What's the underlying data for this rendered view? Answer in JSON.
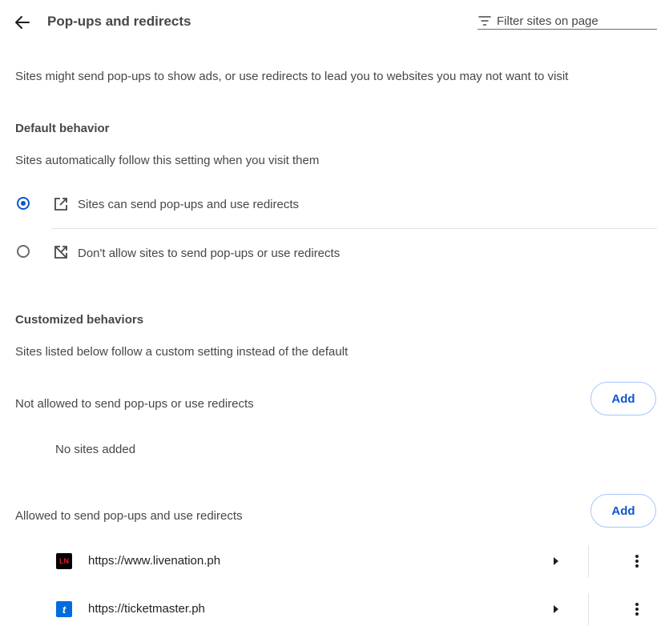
{
  "header": {
    "title": "Pop-ups and redirects",
    "filter_placeholder": "Filter sites on page"
  },
  "description": "Sites might send pop-ups to show ads, or use redirects to lead you to websites you may not want to visit",
  "default_behavior": {
    "heading": "Default behavior",
    "subtext": "Sites automatically follow this setting when you visit them",
    "options": [
      {
        "label": "Sites can send pop-ups and use redirects",
        "selected": true,
        "icon": "open-in-new-icon"
      },
      {
        "label": "Don't allow sites to send pop-ups or use redirects",
        "selected": false,
        "icon": "blocked-popup-icon"
      }
    ]
  },
  "customized": {
    "heading": "Customized behaviors",
    "subtext": "Sites listed below follow a custom setting instead of the default",
    "not_allowed": {
      "label": "Not allowed to send pop-ups or use redirects",
      "add_label": "Add",
      "empty_text": "No sites added"
    },
    "allowed": {
      "label": "Allowed to send pop-ups and use redirects",
      "add_label": "Add",
      "sites": [
        {
          "url": "https://www.livenation.ph",
          "favicon_text": "LN",
          "favicon_bg": "#000000",
          "favicon_fg": "#e21f26"
        },
        {
          "url": "https://ticketmaster.ph",
          "favicon_text": "t",
          "favicon_bg": "#026cdf",
          "favicon_fg": "#ffffff"
        }
      ]
    }
  },
  "colors": {
    "accent": "#0b57d0",
    "text": "#474747",
    "divider": "#e3e3e3"
  }
}
